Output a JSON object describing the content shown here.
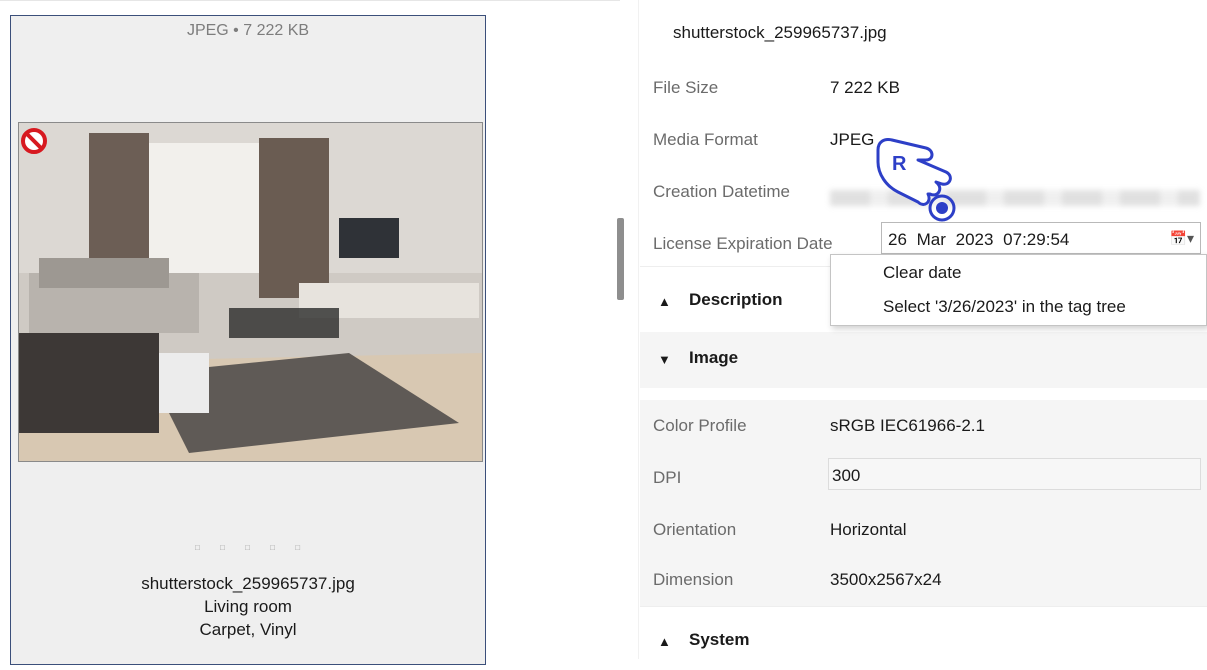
{
  "thumbnail": {
    "format_size": "JPEG • 7 222 KB",
    "dots": "□ □ □ □ □",
    "caption_filename": "shutterstock_259965737.jpg",
    "caption_category": "Living room",
    "caption_tags": "Carpet, Vinyl"
  },
  "properties": {
    "filename": "shutterstock_259965737.jpg",
    "file_size_label": "File Size",
    "file_size_value": "7 222 KB",
    "media_format_label": "Media Format",
    "media_format_value": "JPEG",
    "creation_label": "Creation Datetime",
    "license_label": "License Expiration Date",
    "license_value": "26 Mar 2023 07:29:54",
    "context_menu": {
      "clear": "Clear date",
      "select": "Select '3/26/2023' in the tag tree"
    },
    "sections": {
      "description": "Description",
      "image": "Image",
      "system": "System"
    },
    "image": {
      "color_profile_label": "Color Profile",
      "color_profile_value": "sRGB IEC61966-2.1",
      "dpi_label": "DPI",
      "dpi_value": "300",
      "orientation_label": "Orientation",
      "orientation_value": "Horizontal",
      "dimension_label": "Dimension",
      "dimension_value": "3500x2567x24"
    }
  },
  "pointer": {
    "badge": "R"
  }
}
